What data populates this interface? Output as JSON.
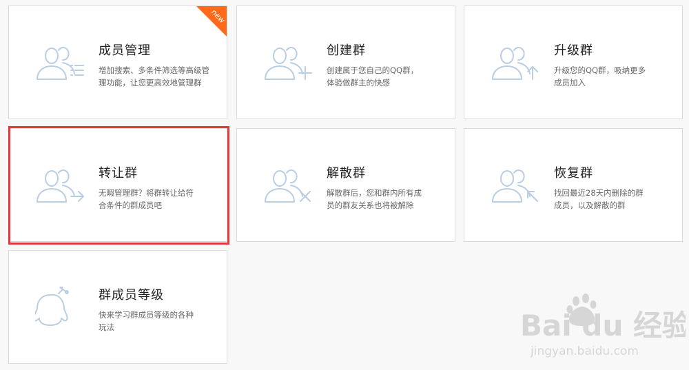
{
  "cards": [
    {
      "title": "成员管理",
      "desc_line1": "增加搜索、多条件筛选等高级管",
      "desc_line2": "理功能，让您更高效地管理群",
      "icon": "member-list-icon",
      "new_badge": "new"
    },
    {
      "title": "创建群",
      "desc_line1": "创建属于您自己的QQ群，",
      "desc_line2": "体验做群主的快感",
      "icon": "create-group-icon"
    },
    {
      "title": "升级群",
      "desc_line1": "升级您的QQ群，吸纳更多",
      "desc_line2": "成员加入",
      "icon": "upgrade-group-icon"
    },
    {
      "title": "转让群",
      "desc_line1": "无暇管理群？将群转让给符",
      "desc_line2": "合条件的群成员吧",
      "icon": "transfer-group-icon"
    },
    {
      "title": "解散群",
      "desc_line1": "解散群后，您和群内所有成",
      "desc_line2": "员的群友关系也将被解除",
      "icon": "dissolve-group-icon"
    },
    {
      "title": "恢复群",
      "desc_line1": "找回最近28天内删除的群",
      "desc_line2": "成员，以及解散的群",
      "icon": "restore-group-icon"
    },
    {
      "title": "群成员等级",
      "desc_line1": "快来学习群成员等级的各种",
      "desc_line2": "玩法",
      "icon": "penguin-icon"
    }
  ],
  "watermark": {
    "brand": "Bai du 经验",
    "url": "jingyan.baidu.com"
  },
  "colors": {
    "icon": "#b9cde3",
    "highlight": "#e4393c",
    "badge": "#ff6a1a"
  }
}
